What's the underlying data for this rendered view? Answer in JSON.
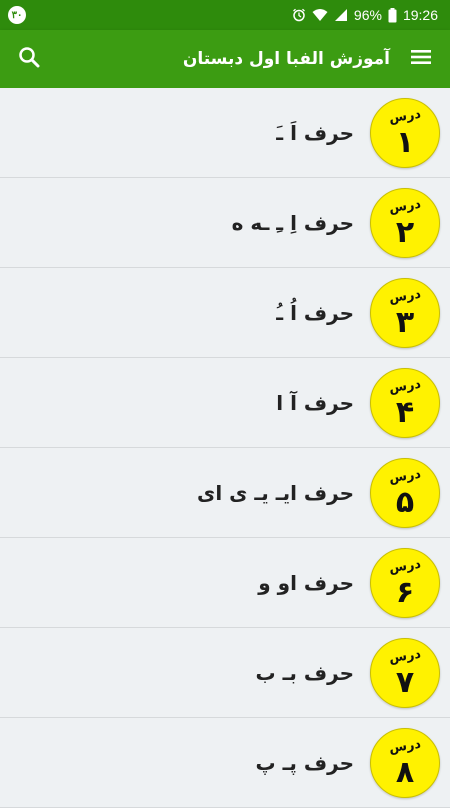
{
  "status_bar": {
    "notification_badge": "۳۰",
    "battery": "96%",
    "time": "19:26"
  },
  "app_bar": {
    "title": "آموزش الفبا اول دبستان"
  },
  "lessons": [
    {
      "label": "درس",
      "number": "۱",
      "title": "حرف اَ ـَ"
    },
    {
      "label": "درس",
      "number": "۲",
      "title": "حرف اِ ـِ ـه ه"
    },
    {
      "label": "درس",
      "number": "۳",
      "title": "حرف اُ ـُ"
    },
    {
      "label": "درس",
      "number": "۴",
      "title": "حرف آ ا"
    },
    {
      "label": "درس",
      "number": "۵",
      "title": "حرف ایـ یـ ی ای"
    },
    {
      "label": "درس",
      "number": "۶",
      "title": "حرف او و"
    },
    {
      "label": "درس",
      "number": "۷",
      "title": "حرف بـ ب"
    },
    {
      "label": "درس",
      "number": "۸",
      "title": "حرف پـ پ"
    }
  ],
  "colors": {
    "status_bar": "#2e8b0c",
    "app_bar": "#3c9c12",
    "badge": "#fff200",
    "background": "#eef1f3"
  }
}
